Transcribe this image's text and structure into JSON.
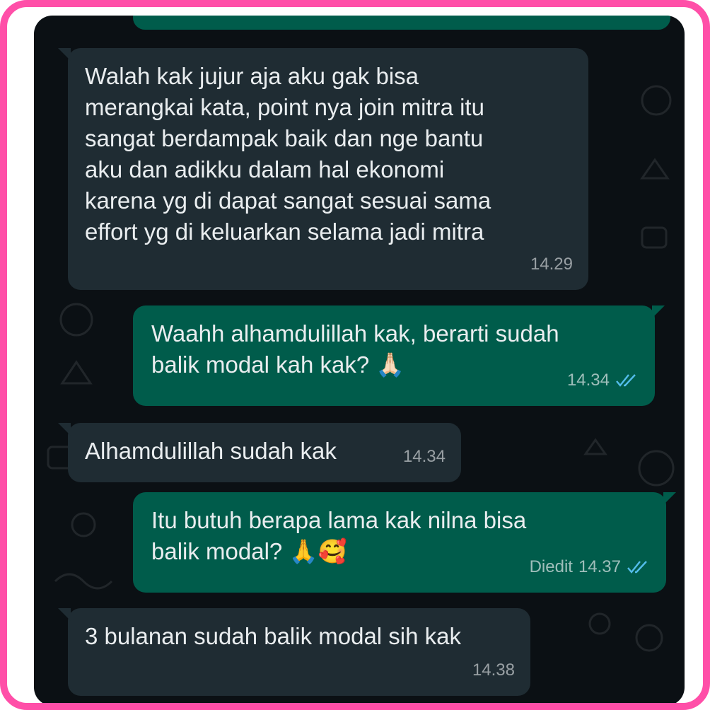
{
  "messages": [
    {
      "direction": "outgoing",
      "text": "",
      "partial": true
    },
    {
      "direction": "incoming",
      "text": "Walah kak jujur aja aku gak bisa\nmerangkai kata, point nya join mitra itu\nsangat berdampak baik dan nge bantu\naku dan adikku dalam hal ekonomi\nkarena yg di dapat sangat sesuai sama\neffort yg di keluarkan selama jadi mitra",
      "time": "14.29"
    },
    {
      "direction": "outgoing",
      "text": "Waahh alhamdulillah kak, berarti sudah\nbalik modal kah kak?",
      "emoji": "🙏🏻",
      "time": "14.34",
      "status": "read-ticks"
    },
    {
      "direction": "incoming",
      "text": "Alhamdulillah sudah kak",
      "time": "14.34"
    },
    {
      "direction": "outgoing",
      "text": "Itu butuh berapa lama kak nilna bisa\nbalik modal?",
      "emoji": "🙏🥰",
      "edited_label": "Diedit",
      "time": "14.37",
      "status": "read-ticks"
    },
    {
      "direction": "incoming",
      "text": "3 bulanan sudah balik modal sih kak",
      "time": "14.38"
    }
  ],
  "colors": {
    "frame_border": "#ff4fa8",
    "chat_background": "#0b1014",
    "incoming_bubble": "#1f2c33",
    "outgoing_bubble": "#005c4b",
    "read_ticks": "#53bdeb"
  }
}
